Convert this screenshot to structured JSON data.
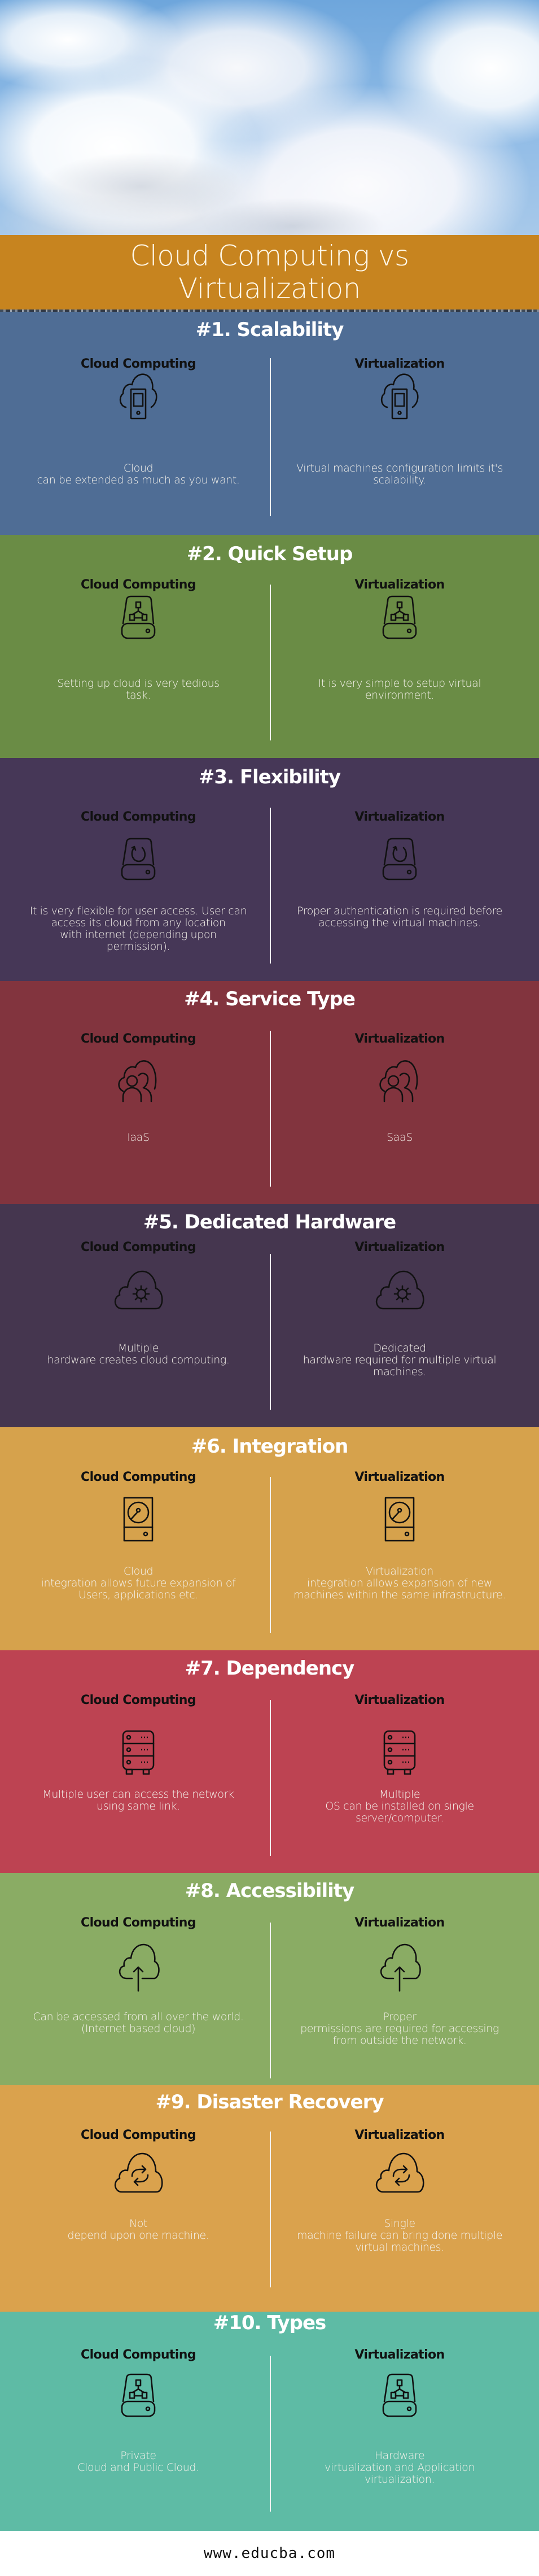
{
  "title": {
    "line1": "Cloud Computing vs",
    "line2": "Virtualization",
    "banner_color": "#c7841f"
  },
  "column_headers": {
    "left": "Cloud Computing",
    "right": "Virtualization"
  },
  "sections": [
    {
      "title": "#1. Scalability",
      "color": "#4f6d95",
      "icon": "cloud-mobile-icon",
      "left_text": "Cloud\ncan be extended as much as you want.",
      "right_text": "Virtual machines configuration limits it's\nscalability."
    },
    {
      "title": "#2. Quick Setup",
      "color": "#6a8c45",
      "icon": "drive-network-icon",
      "left_text": "Setting up cloud is very tedious\ntask.",
      "right_text": "It is very simple to setup virtual\nenvironment."
    },
    {
      "title": "#3. Flexibility",
      "color": "#463757",
      "icon": "drive-refresh-icon",
      "left_text": "It is very flexible for user access. User can\naccess its cloud from any location\nwith internet (depending upon\npermission).",
      "right_text": "Proper authentication is required before\naccessing the virtual machines."
    },
    {
      "title": "#4. Service Type",
      "color": "#82343e",
      "icon": "cloud-users-icon",
      "left_text": "IaaS",
      "right_text": "SaaS"
    },
    {
      "title": "#5. Dedicated Hardware",
      "color": "#45364f",
      "icon": "cloud-gear-icon",
      "left_text": "Multiple\nhardware creates cloud computing.",
      "right_text": "Dedicated\nhardware required for multiple virtual\nmachines."
    },
    {
      "title": "#6. Integration",
      "color": "#d6a24c",
      "icon": "hard-disk-icon",
      "left_text": "Cloud\nintegration allows future expansion of\nUsers, applications etc.",
      "right_text": "Virtualization\nintegration allows expansion of new\nmachines within the same infrastructure."
    },
    {
      "title": "#7. Dependency",
      "color": "#bd4352",
      "icon": "server-rack-icon",
      "left_text": "Multiple user can access the network\nusing same link.",
      "right_text": "Multiple\nOS can be installed on single\nserver/computer."
    },
    {
      "title": "#8. Accessibility",
      "color": "#8aac64",
      "icon": "cloud-upload-icon",
      "left_text": "Can be accessed from all over the world.\n(Internet based cloud)",
      "right_text": "Proper\npermissions are required for accessing\nfrom outside the network."
    },
    {
      "title": "#9. Disaster Recovery",
      "color": "#daa24d",
      "icon": "cloud-sync-icon",
      "left_text": "Not\ndepend upon one machine.",
      "right_text": "Single\nmachine failure can bring done multiple\nvirtual machines."
    },
    {
      "title": "#10. Types",
      "color": "#5ebba5",
      "icon": "drive-network-icon",
      "left_text": "Private\nCloud and Public Cloud.",
      "right_text": "Hardware\nvirtualization and Application\nvirtualization."
    }
  ],
  "footer": {
    "url": "www.educba.com"
  }
}
